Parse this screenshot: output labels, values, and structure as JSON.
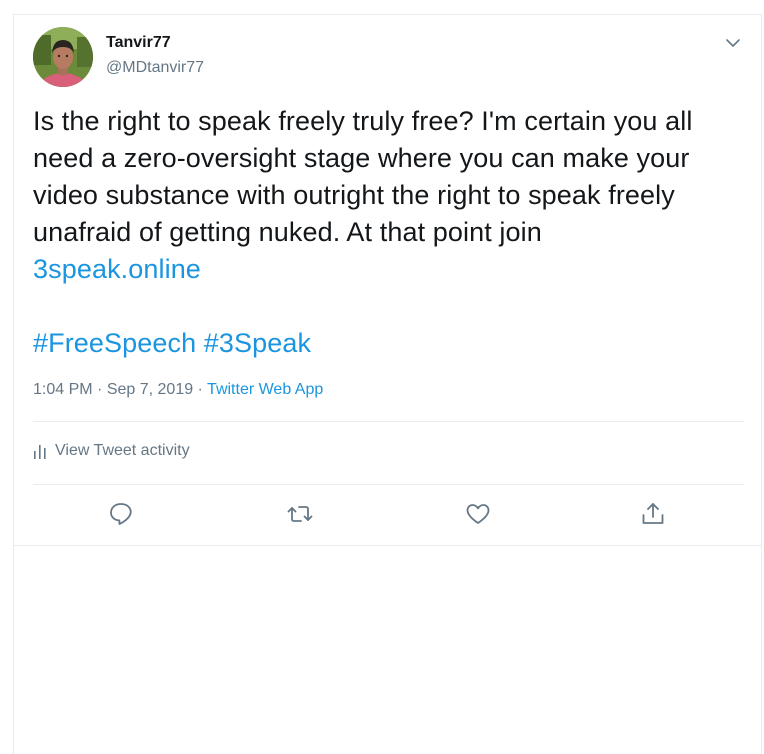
{
  "user": {
    "display_name": "Tanvir77",
    "handle": "@MDtanvir77"
  },
  "tweet": {
    "lines": [
      "Is the right to speak freely truly free? I'm certain you all",
      "need a zero-oversight stage where you can make your",
      "video substance with outright the right to speak freely",
      "unafraid of getting nuked. At that point join"
    ],
    "link": "3speak.online",
    "hashtags": "#FreeSpeech #3Speak"
  },
  "meta": {
    "time": "1:04 PM",
    "separator1": " · ",
    "date": "Sep 7, 2019",
    "separator2": " · ",
    "source": "Twitter Web App"
  },
  "activity": {
    "label": "View Tweet activity"
  },
  "icons": {
    "more": "chevron-down-icon",
    "activity": "bar-chart-icon",
    "reply": "reply-icon",
    "retweet": "retweet-icon",
    "like": "heart-icon",
    "share": "share-icon"
  },
  "colors": {
    "text": "#14171a",
    "secondary": "#657786",
    "link": "#1b95e0",
    "border": "#e6ecf0"
  }
}
